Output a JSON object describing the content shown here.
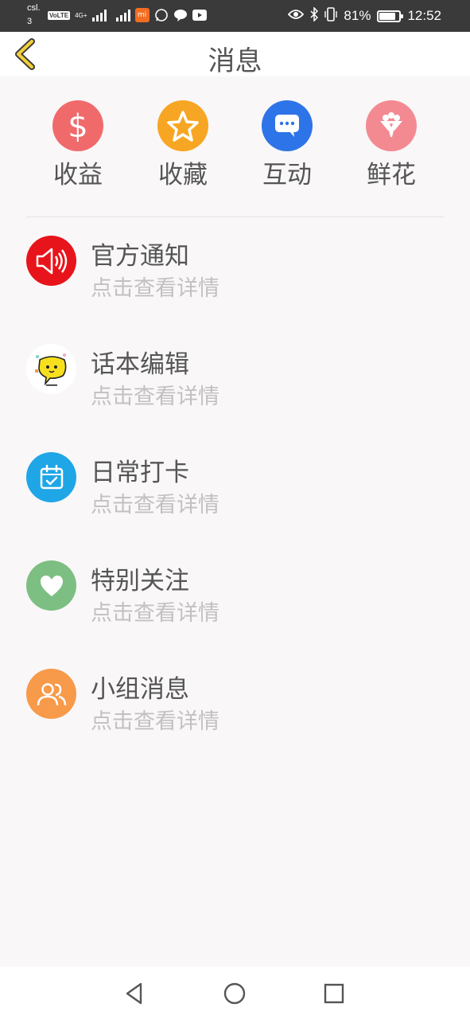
{
  "status_bar": {
    "carrier_line1": "csl.",
    "carrier_line2": "3",
    "volte": "VoLTE",
    "network": "4G+",
    "battery_percent_text": "81%",
    "battery_level": 0.81,
    "time": "12:52"
  },
  "header": {
    "title": "消息",
    "back_icon": "chevron-left-icon"
  },
  "categories": [
    {
      "label": "收益",
      "icon": "dollar-icon",
      "color": "#f06a6c"
    },
    {
      "label": "收藏",
      "icon": "star-icon",
      "color": "#f7a623"
    },
    {
      "label": "互动",
      "icon": "chat-bubble-icon",
      "color": "#2d74e8"
    },
    {
      "label": "鲜花",
      "icon": "bouquet-icon",
      "color": "#f38a92"
    }
  ],
  "messages": [
    {
      "title": "官方通知",
      "subtitle": "点击查看详情",
      "icon": "speaker-icon",
      "color": "#e8141b"
    },
    {
      "title": "话本编辑",
      "subtitle": "点击查看详情",
      "icon": "mascot-icon",
      "color": "#ffffff"
    },
    {
      "title": "日常打卡",
      "subtitle": "点击查看详情",
      "icon": "calendar-check-icon",
      "color": "#1ea6e6"
    },
    {
      "title": "特别关注",
      "subtitle": "点击查看详情",
      "icon": "heart-icon",
      "color": "#7dbf82"
    },
    {
      "title": "小组消息",
      "subtitle": "点击查看详情",
      "icon": "group-icon",
      "color": "#f79a4a"
    }
  ],
  "nav": {
    "back_icon": "triangle-back-icon",
    "home_icon": "circle-home-icon",
    "recents_icon": "square-recents-icon"
  }
}
